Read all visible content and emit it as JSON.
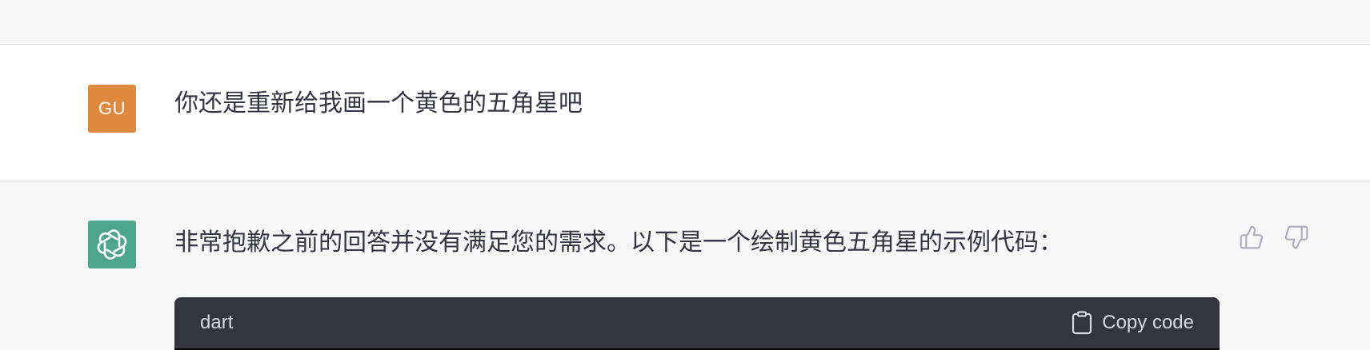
{
  "conversation": {
    "user": {
      "avatar_initials": "GU",
      "avatar_color": "#dd8a3e",
      "message": "你还是重新给我画一个黄色的五角星吧"
    },
    "assistant": {
      "avatar_icon": "openai-logo-icon",
      "avatar_color": "#4ea58a",
      "message": "非常抱歉之前的回答并没有满足您的需求。以下是一个绘制黄色五角星的示例代码：",
      "feedback_icons": [
        "thumbs-up-icon",
        "thumbs-down-icon"
      ],
      "code_block": {
        "language": "dart",
        "copy_label": "Copy code",
        "copy_icon": "clipboard-icon",
        "background": "#343541"
      }
    }
  }
}
